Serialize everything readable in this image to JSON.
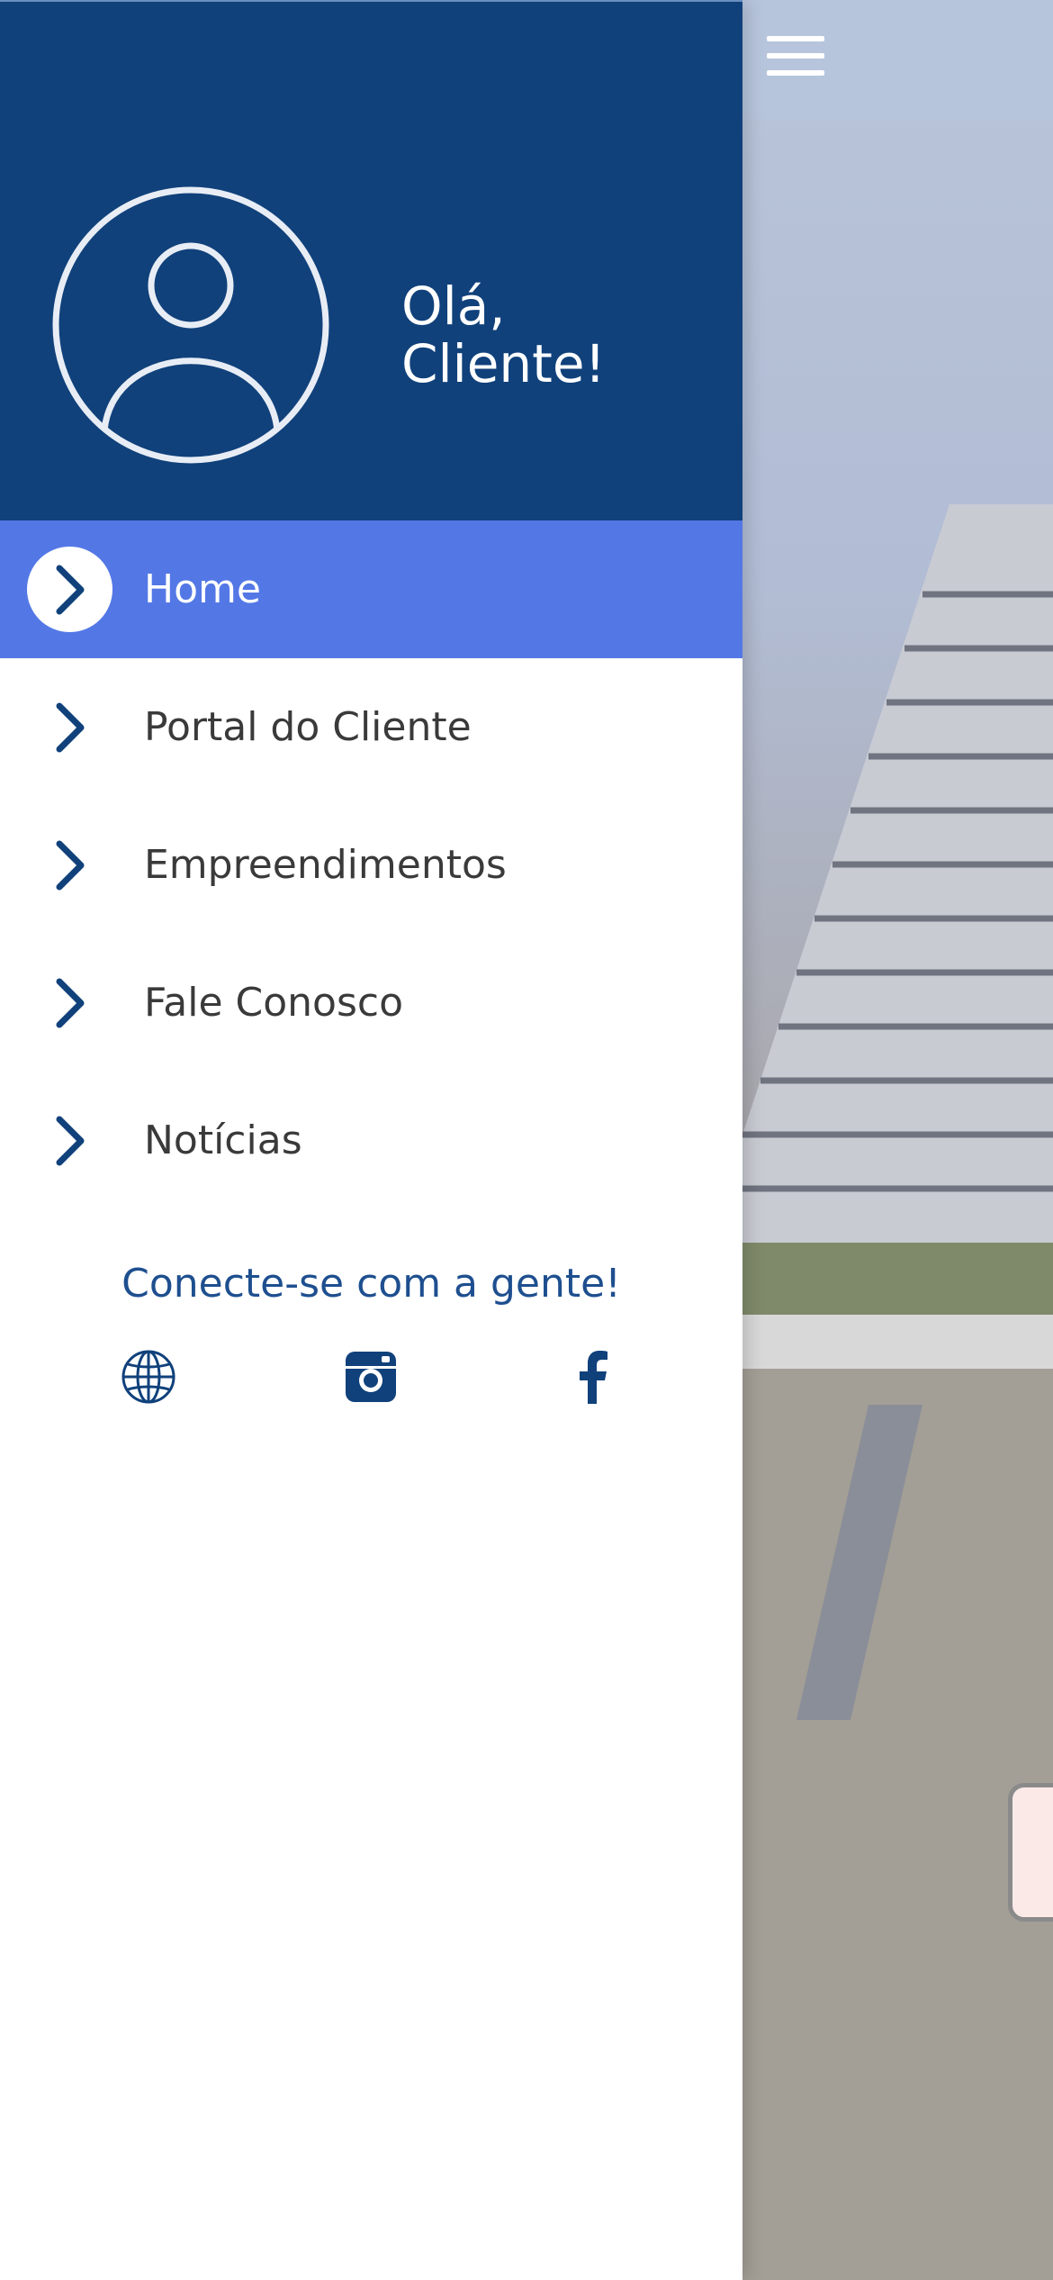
{
  "header": {
    "greeting": "Olá,\nCliente!"
  },
  "nav": {
    "items": [
      {
        "label": "Home",
        "active": true
      },
      {
        "label": "Portal do Cliente",
        "active": false
      },
      {
        "label": "Empreendimentos",
        "active": false
      },
      {
        "label": "Fale Conosco",
        "active": false
      },
      {
        "label": "Notícias",
        "active": false
      }
    ]
  },
  "social": {
    "title": "Conecte-se com a gente!",
    "icons": [
      "globe-icon",
      "instagram-icon",
      "facebook-icon"
    ]
  },
  "colors": {
    "header_bg": "#10417b",
    "active_item_bg": "#5378e6",
    "accent": "#1e4f8f"
  }
}
